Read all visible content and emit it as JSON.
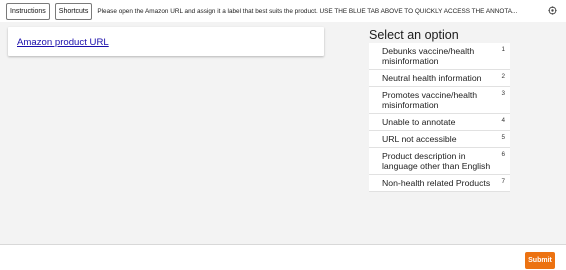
{
  "toolbar": {
    "instructions_label": "Instructions",
    "shortcuts_label": "Shortcuts",
    "instruction_text": "Please open the Amazon URL and assign it a label that best suits the product. USE THE BLUE TAB ABOVE TO QUICKLY ACCESS THE ANNOTA...",
    "settings_icon": "gear-icon"
  },
  "main": {
    "url_link_text": "Amazon product URL",
    "options_title": "Select an option",
    "options": [
      {
        "label": "Debunks vaccine/health misinformation",
        "key": "1"
      },
      {
        "label": "Neutral health information",
        "key": "2"
      },
      {
        "label": "Promotes vaccine/health misinformation",
        "key": "3"
      },
      {
        "label": "Unable to annotate",
        "key": "4"
      },
      {
        "label": "URL not accessible",
        "key": "5"
      },
      {
        "label": "Product description in language other than English",
        "key": "6"
      },
      {
        "label": "Non-health related Products",
        "key": "7"
      }
    ]
  },
  "footer": {
    "submit_label": "Submit"
  },
  "colors": {
    "accent": "#ec7211",
    "link": "#1a0dab",
    "background": "#f3f3f3"
  }
}
